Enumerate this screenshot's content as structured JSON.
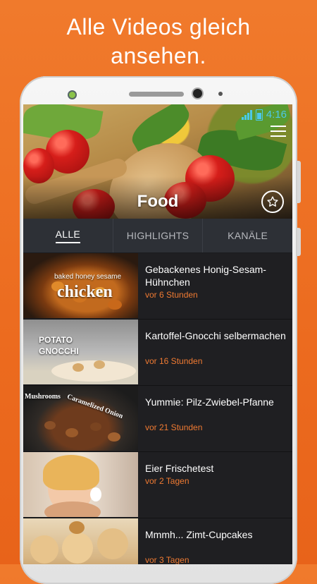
{
  "promo": {
    "headline_line1": "Alle Videos gleich",
    "headline_line2": "ansehen."
  },
  "statusbar": {
    "time": "4:16",
    "text_color": "#4dc8e8"
  },
  "channel": {
    "title": "Food",
    "favorite_icon": "star-outline-icon",
    "menu_icon": "hamburger-menu-icon"
  },
  "tabs": [
    {
      "label": "ALLE",
      "active": true
    },
    {
      "label": "HIGHLIGHTS",
      "active": false
    },
    {
      "label": "KANÄLE",
      "active": false
    }
  ],
  "videos": [
    {
      "title": "Gebackenes Honig-Sesam-Hühnchen",
      "time": "vor 6 Stunden",
      "thumb_caption_1": "baked honey sesame",
      "thumb_caption_2": "chicken"
    },
    {
      "title": "Kartoffel-Gnocchi selbermachen",
      "time": "vor 16 Stunden",
      "thumb_caption_1": "POTATO",
      "thumb_caption_2": "GNOCCHI"
    },
    {
      "title": "Yummie: Pilz-Zwiebel-Pfanne",
      "time": "vor 21 Stunden",
      "thumb_caption_1": "Mushrooms",
      "thumb_caption_2": "Caramelized Onion"
    },
    {
      "title": "Eier Frischetest",
      "time": "vor 2 Tagen"
    },
    {
      "title": "Mmmh... Zimt-Cupcakes",
      "time": "vor 3 Tagen"
    }
  ],
  "colors": {
    "background_orange": "#ec6b1f",
    "accent_time": "#ef7a32",
    "list_background": "#1f1f22",
    "tab_bar": "#2d3036"
  }
}
